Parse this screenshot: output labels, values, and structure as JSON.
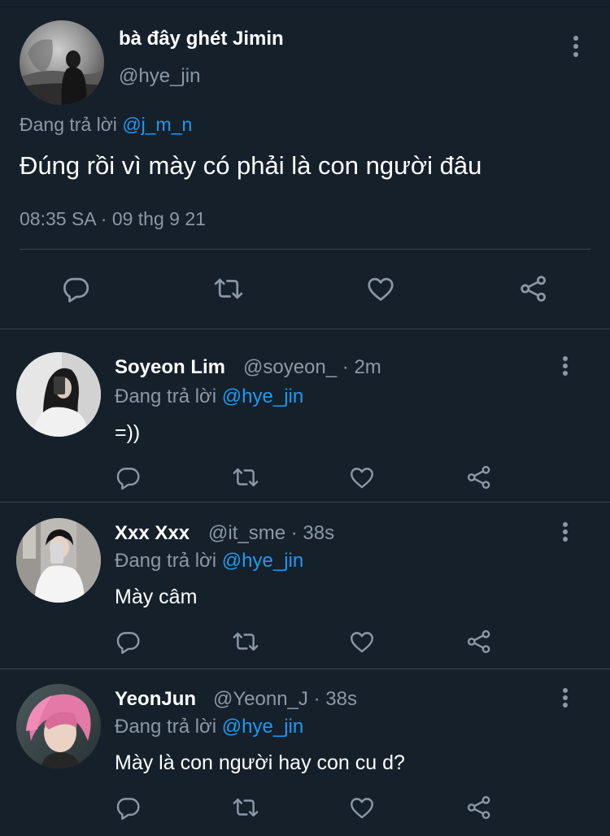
{
  "main_tweet": {
    "display_name": "bà đây ghét Jimin",
    "handle": "@hye_jin",
    "replying_prefix": "Đang trả lời",
    "replying_to": "@j_m_n",
    "text": "Đúng rồi vì mày có phải là con người đâu",
    "time": "08:35 SA",
    "separator": "·",
    "date": "09 thg 9 21"
  },
  "replies": [
    {
      "display_name": "Soyeon Lim",
      "handle": "@soyeon_",
      "separator": "·",
      "time": "2m",
      "replying_prefix": "Đang trả lời",
      "replying_to": "@hye_jin",
      "text": "=))"
    },
    {
      "display_name": "Xxx Xxx",
      "handle": "@it_sme",
      "separator": "·",
      "time": "38s",
      "replying_prefix": "Đang trả lời",
      "replying_to": "@hye_jin",
      "text": "Mày câm"
    },
    {
      "display_name": "YeonJun",
      "handle": "@Yeonn_J",
      "separator": "·",
      "time": "38s",
      "replying_prefix": "Đang trả lời",
      "replying_to": "@hye_jin",
      "text": "Mày là con người hay con cu d?"
    }
  ],
  "icons": [
    "reply-icon",
    "retweet-icon",
    "like-icon",
    "share-icon",
    "more-icon"
  ],
  "colors": {
    "background": "#15202b",
    "text": "#ffffff",
    "muted": "#8b98a5",
    "link": "#1d9bf0",
    "divider": "#38444d"
  }
}
